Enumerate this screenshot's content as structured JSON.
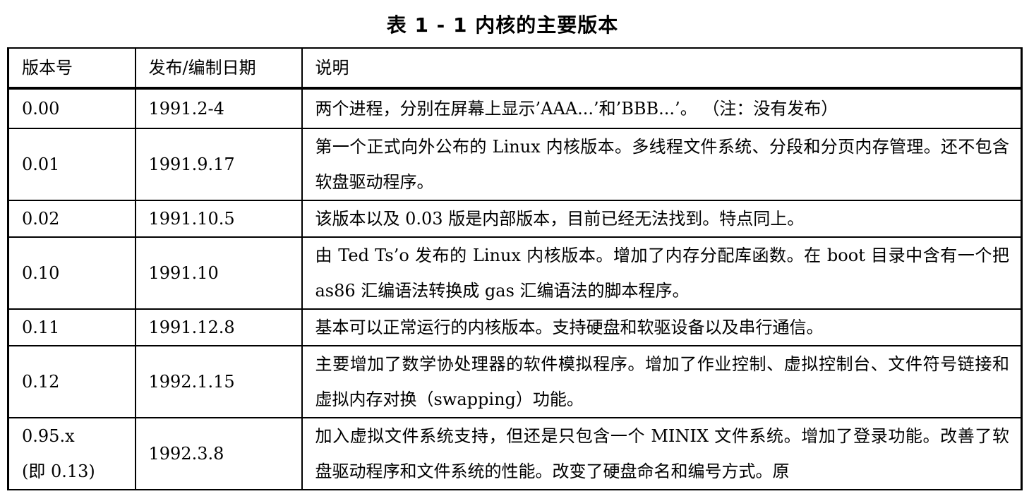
{
  "caption": "表 1 - 1 内核的主要版本",
  "columns": [
    "版本号",
    "发布/编制日期",
    "说明"
  ],
  "rows": [
    {
      "version": "0.00",
      "date": "1991.2-4",
      "description": "两个进程，分别在屏幕上显示’AAA...’和’BBB...’。 （注：没有发布）"
    },
    {
      "version": "0.01",
      "date": "1991.9.17",
      "description": "第一个正式向外公布的 Linux 内核版本。多线程文件系统、分段和分页内存管理。还不包含软盘驱动程序。"
    },
    {
      "version": "0.02",
      "date": "1991.10.5",
      "description": "该版本以及 0.03 版是内部版本，目前已经无法找到。特点同上。"
    },
    {
      "version": "0.10",
      "date": "1991.10",
      "description": "由 Ted Ts’o 发布的 Linux 内核版本。增加了内存分配库函数。在 boot 目录中含有一个把 as86 汇编语法转换成 gas 汇编语法的脚本程序。"
    },
    {
      "version": "0.11",
      "date": "1991.12.8",
      "description": "基本可以正常运行的内核版本。支持硬盘和软驱设备以及串行通信。"
    },
    {
      "version": "0.12",
      "date": "1992.1.15",
      "description": "主要增加了数学协处理器的软件模拟程序。增加了作业控制、虚拟控制台、文件符号链接和虚拟内存对换（swapping）功能。"
    },
    {
      "version": "0.95.x",
      "version_note": "(即 0.13)",
      "date": "1992.3.8",
      "description": "加入虚拟文件系统支持，但还是只包含一个 MINIX 文件系统。增加了登录功能。改善了软盘驱动程序和文件系统的性能。改变了硬盘命名和编号方式。原"
    }
  ]
}
